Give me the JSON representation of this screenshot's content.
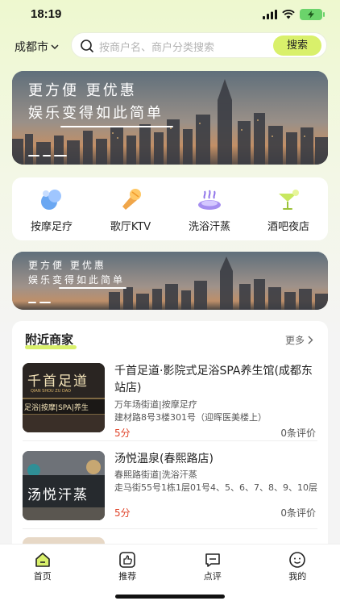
{
  "status_bar": {
    "time": "18:19"
  },
  "header": {
    "city": "成都市",
    "search_placeholder": "按商户名、商户分类搜索",
    "search_button": "搜索"
  },
  "banner": {
    "line1": "更方便 更优惠",
    "line2": "娱乐变得如此简单"
  },
  "categories": [
    {
      "label": "按摩足疗",
      "icon": "massage-icon"
    },
    {
      "label": "歌厅KTV",
      "icon": "microphone-icon"
    },
    {
      "label": "洗浴汗蒸",
      "icon": "sauna-icon"
    },
    {
      "label": "酒吧夜店",
      "icon": "cocktail-icon"
    }
  ],
  "nearby": {
    "title": "附近商家",
    "more": "更多",
    "merchants": [
      {
        "name": "千首足道·影院式足浴SPA养生馆(成都东站店)",
        "area": "万年场街道|按摩足疗",
        "address": "建材路8号3楼301号（迎晖医美楼上）",
        "score": "5分",
        "reviews": "0条评价",
        "thumb_text": "千首足道",
        "thumb_sub": "QIAN SHOU ZU DAO",
        "thumb_tags": "足浴|按摩|SPA|养生"
      },
      {
        "name": "汤悦温泉(春熙路店)",
        "area": "春熙路街道|洗浴汗蒸",
        "address": "走马街55号1栋1层01号4、5、6、7、8、9、10层",
        "score": "5分",
        "reviews": "0条评价",
        "thumb_text": "汤悦汗蒸"
      }
    ]
  },
  "tabbar": [
    {
      "label": "首页",
      "icon": "home-icon"
    },
    {
      "label": "推荐",
      "icon": "thumbs-up-icon"
    },
    {
      "label": "点评",
      "icon": "comment-icon"
    },
    {
      "label": "我的",
      "icon": "profile-icon"
    }
  ],
  "colors": {
    "accent": "#d9f06b",
    "score": "#e0442a",
    "background": "#f4f4f4"
  }
}
